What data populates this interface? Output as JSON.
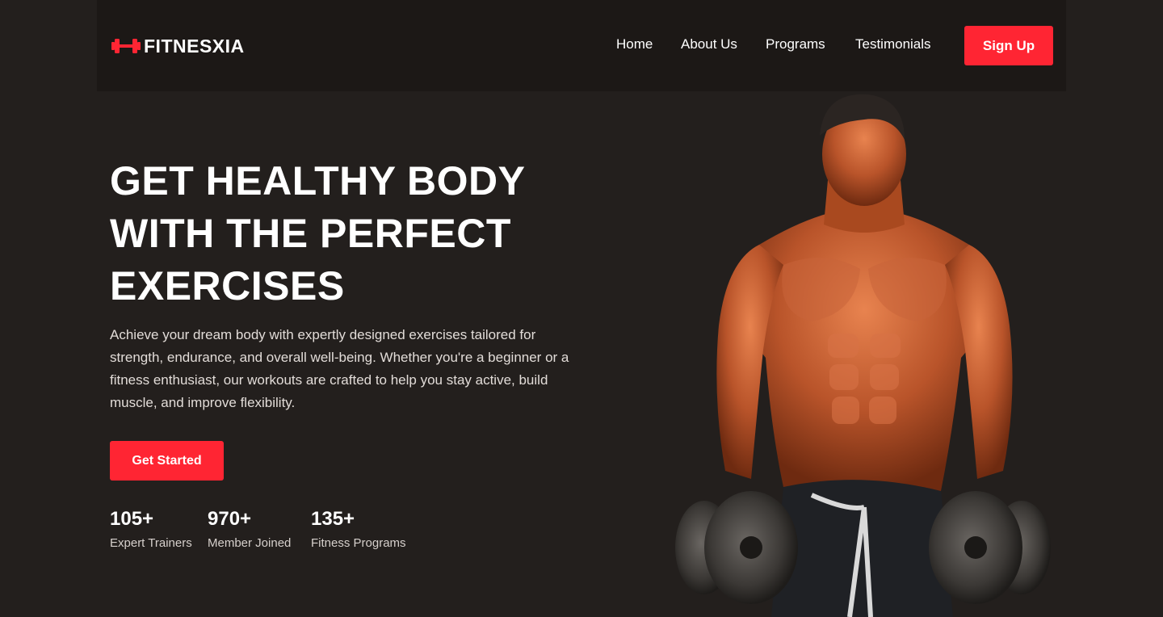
{
  "header": {
    "brand": {
      "name": "FITNESXIA",
      "icon": "dumbbell-icon"
    },
    "nav": [
      {
        "label": "Home"
      },
      {
        "label": "About Us"
      },
      {
        "label": "Programs"
      },
      {
        "label": "Testimonials"
      }
    ],
    "signup_label": "Sign Up"
  },
  "hero": {
    "title_lines": [
      "GET HEALTHY BODY",
      "WITH THE PERFECT",
      "EXERCISES"
    ],
    "description": "Achieve your dream body with expertly designed exercises tailored for strength, endurance, and overall well-being. Whether you're a beginner or a fitness enthusiast, our workouts are crafted to help you stay active, build muscle, and improve flexibility.",
    "cta_label": "Get Started",
    "stats": [
      {
        "value": "105+",
        "label": "Expert Trainers"
      },
      {
        "value": "970+",
        "label": "Member Joined"
      },
      {
        "value": "135+",
        "label": "Fitness Programs"
      }
    ],
    "image": "muscular-athlete-with-dumbbells"
  },
  "colors": {
    "background": "#231f1d",
    "header_background": "#1c1816",
    "accent": "#ff2533",
    "text": "#ffffff"
  }
}
